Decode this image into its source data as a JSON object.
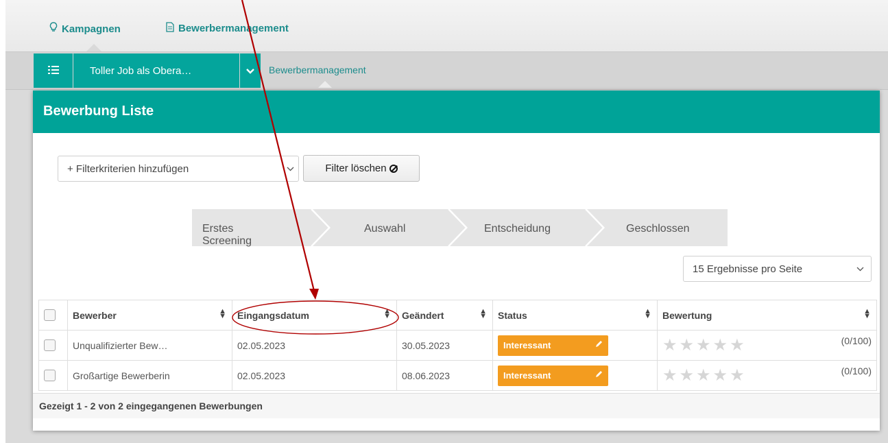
{
  "topnav": {
    "campaigns_label": "Kampagnen",
    "applicant_mgmt_label": "Bewerbermanagement"
  },
  "subbar": {
    "job_title": "Toller Job als Obera…",
    "breadcrumb": "Bewerbermanagement"
  },
  "panel": {
    "title": "Bewerbung Liste"
  },
  "filters": {
    "add_criteria": "+ Filterkriterien hinzufügen",
    "clear_label": "Filter löschen"
  },
  "stages": [
    "Erstes Screening",
    "Auswahl",
    "Entscheidung",
    "Geschlossen"
  ],
  "per_page": "15 Ergebnisse pro Seite",
  "table": {
    "headers": [
      "Bewerber",
      "Eingangsdatum",
      "Geändert",
      "Status",
      "Bewertung"
    ],
    "rows": [
      {
        "name": "Unqualifizierter Bew…",
        "received": "02.05.2023",
        "changed": "30.05.2023",
        "status": "Interessant",
        "score": "(0/100)",
        "rating": 0
      },
      {
        "name": "Großartige Bewerberin",
        "received": "02.05.2023",
        "changed": "08.06.2023",
        "status": "Interessant",
        "score": "(0/100)",
        "rating": 0
      }
    ]
  },
  "footer": "Gezeigt 1 - 2 von 2 eingegangenen Bewerbungen",
  "colors": {
    "teal": "#00a398",
    "link": "#1c8c8c",
    "status": "#f39c1f",
    "annotation": "#b00000"
  },
  "icons": [
    "lightbulb-icon",
    "document-icon",
    "list-icon",
    "chevron-down-icon",
    "ban-icon",
    "sort-icon",
    "pencil-icon",
    "star-icon"
  ]
}
